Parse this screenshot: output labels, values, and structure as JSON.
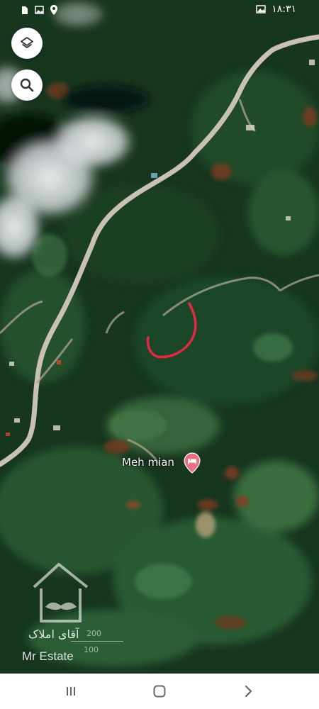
{
  "status_bar": {
    "time": "۱۸:۳۱",
    "icons": [
      "sim-card-icon",
      "image-notification-icon",
      "location-icon",
      "gallery-icon"
    ]
  },
  "map": {
    "view": "satellite",
    "place_label": "Meh mian",
    "place_icon": "hotel-bed-icon",
    "pin_color": "#e8717f",
    "annotation_color": "#e2293f",
    "road_color": "#c9c2b4"
  },
  "controls": {
    "layers_icon": "layers-icon",
    "search_icon": "search-icon"
  },
  "scale_bar": {
    "top": "200",
    "bottom": "100"
  },
  "watermark": {
    "fa": "آقای املاک",
    "en": "Mr Estate"
  },
  "nav_bar": {
    "recents_icon": "recents-icon",
    "home_icon": "home-icon",
    "back_icon": "back-icon"
  }
}
